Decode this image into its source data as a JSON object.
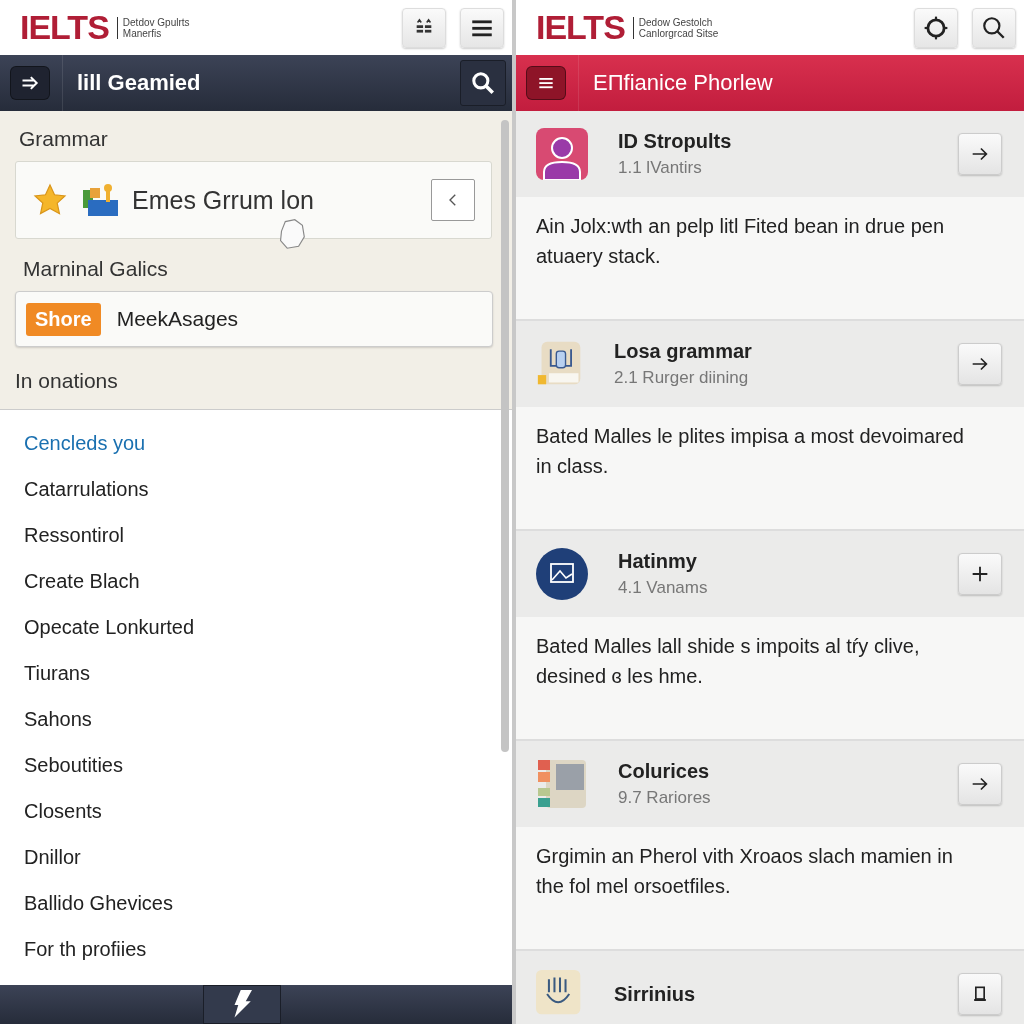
{
  "left_panel": {
    "header": {
      "logo": "IELTS",
      "tagline": [
        "Detdov Gpulrts",
        "Manerfis"
      ],
      "buttons": [
        {
          "kind": "grid"
        },
        {
          "kind": "menu"
        }
      ]
    },
    "nav_bar": {
      "title": "lill Geamied"
    },
    "grammar": {
      "heading": "Grammar",
      "card_text": "Emes Grrum lon"
    },
    "section_2": {
      "heading": "Marninal Galics",
      "badge": "Shore",
      "text": "MeekAsages"
    },
    "section_3": {
      "heading": "In onations"
    },
    "list": [
      {
        "label": "Cencleds you",
        "selected": true
      },
      {
        "label": "Catarrulations",
        "selected": false
      },
      {
        "label": "Ressontirol",
        "selected": false
      },
      {
        "label": "Create Blach",
        "selected": false
      },
      {
        "label": "Opecate Lonkurted",
        "selected": false
      },
      {
        "label": "Tiurans",
        "selected": false
      },
      {
        "label": "Sahons",
        "selected": false
      },
      {
        "label": "Seboutities",
        "selected": false
      },
      {
        "label": "Closents",
        "selected": false
      },
      {
        "label": "Dnillor",
        "selected": false
      },
      {
        "label": "Ballido Ghevices",
        "selected": false
      },
      {
        "label": "For th profiies",
        "selected": false
      }
    ]
  },
  "right_panel": {
    "header": {
      "logo": "IELTS",
      "tagline": [
        "Dedow Gestolch",
        "Canlorgrcad Sitse"
      ],
      "buttons": [
        {
          "kind": "settings"
        },
        {
          "kind": "search"
        }
      ]
    },
    "nav_bar": {
      "title": "EΠfianice Phorlew"
    },
    "cards": [
      {
        "kind": "arrow",
        "title": "ID Stropults",
        "subtitle": "1.1 lVantirs",
        "body": "Ain Jolx:wth an pelp litl Fited bean in drue pen atuaery stack."
      },
      {
        "kind": "arrow",
        "title": "Losa grammar",
        "subtitle": "2.1 Rurger diining",
        "body": "Bated Malles le plites impisa a most devoimared in class."
      },
      {
        "kind": "plus",
        "title": "Hatinmy",
        "subtitle": "4.1 Vanams",
        "body": "Bated Malles lall shide s impoits al tŕy clive, desined ɞ les hme."
      },
      {
        "kind": "arrow",
        "title": "Colurices",
        "subtitle": "9.7 Rariores",
        "body": "Grgimin an Pherol vith Xroaos slach mamien in the fol mel orsoetfiles."
      },
      {
        "kind": "device",
        "title": "Sirrinius"
      }
    ]
  }
}
